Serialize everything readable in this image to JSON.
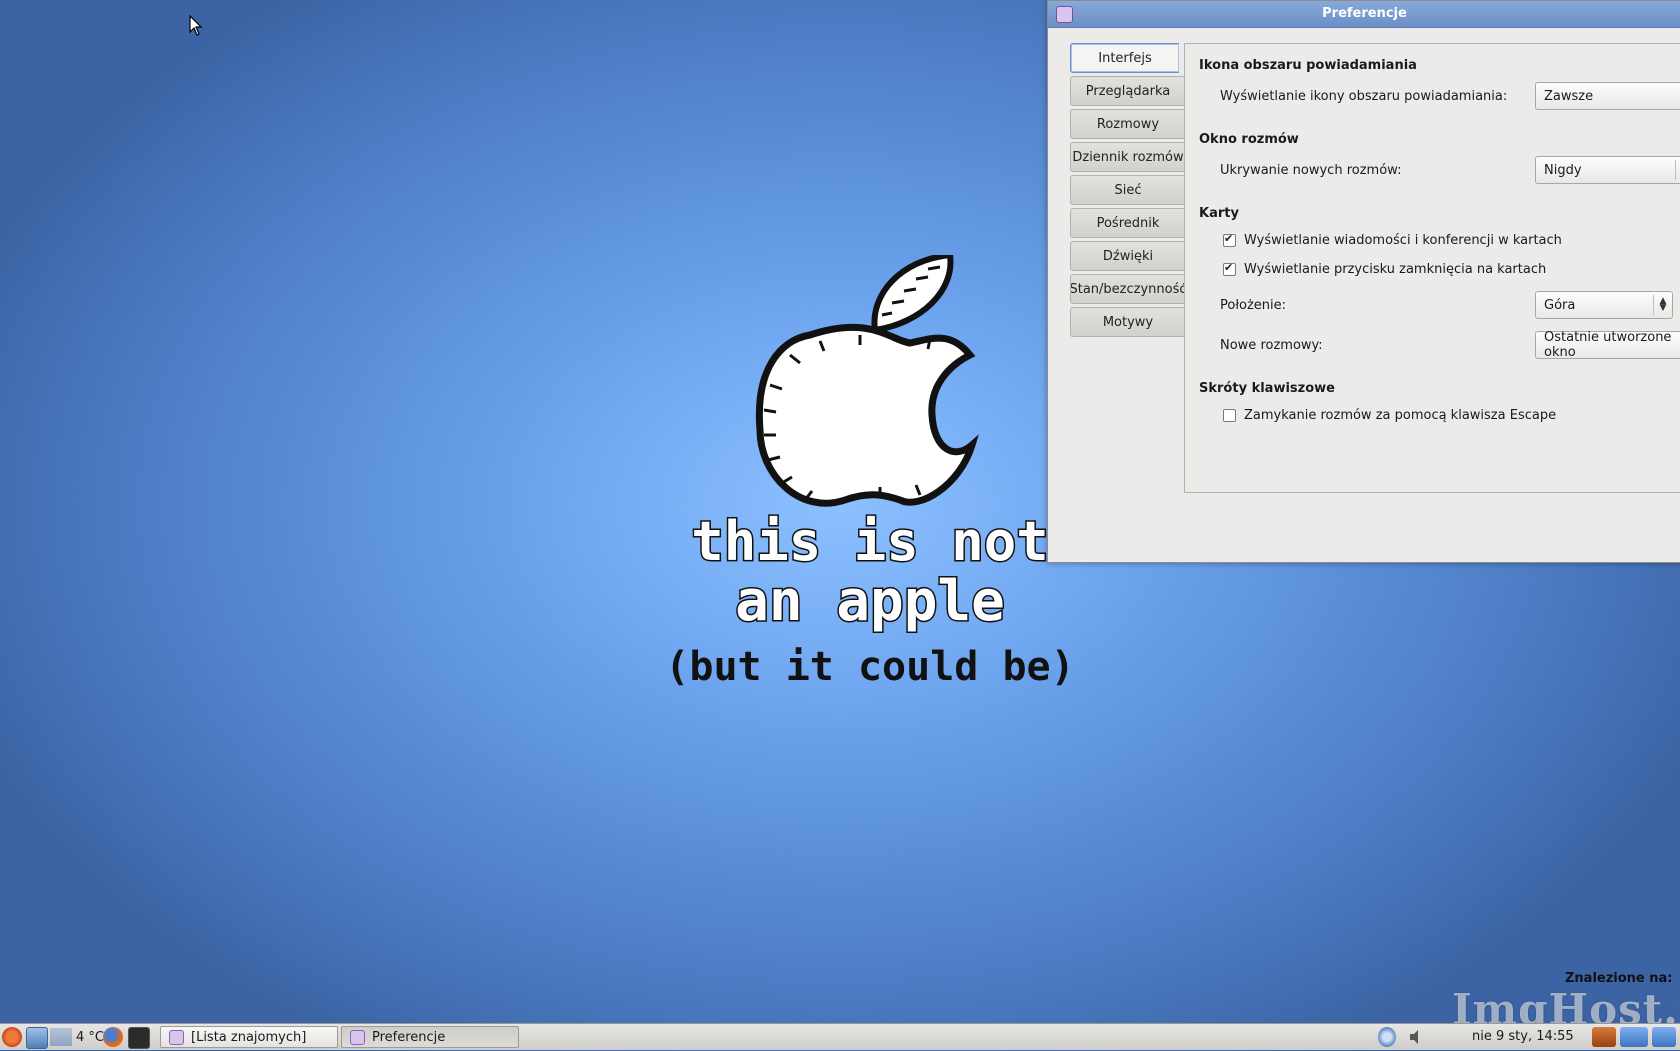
{
  "desktop": {
    "wallpaper": {
      "line1": "this is not",
      "line2": "an apple",
      "line3": "(but it could be)"
    },
    "watermark": {
      "found_on": "Znalezione na:",
      "brand": "ImgHost.pl"
    }
  },
  "dialog": {
    "title": "Preferencje",
    "tabs": [
      {
        "label": "Interfejs",
        "active": true
      },
      {
        "label": "Przeglądarka"
      },
      {
        "label": "Rozmowy"
      },
      {
        "label": "Dziennik rozmów"
      },
      {
        "label": "Sieć"
      },
      {
        "label": "Pośrednik"
      },
      {
        "label": "Dźwięki"
      },
      {
        "label": "Stan/bezczynność"
      },
      {
        "label": "Motywy"
      }
    ],
    "sections": {
      "tray": {
        "heading": "Ikona obszaru powiadamiania",
        "show_icon_label": "Wyświetlanie ikony obszaru powiadamiania:",
        "show_icon_value": "Zawsze"
      },
      "conv_window": {
        "heading": "Okno rozmów",
        "hide_new_label": "Ukrywanie nowych rozmów:",
        "hide_new_value": "Nigdy"
      },
      "tabs": {
        "heading": "Karty",
        "show_in_tabs": "Wyświetlanie wiadomości i konferencji w kartach",
        "show_close_btn": "Wyświetlanie przycisku zamknięcia na kartach",
        "position_label": "Położenie:",
        "position_value": "Góra",
        "new_conv_label": "Nowe rozmowy:",
        "new_conv_value": "Ostatnie utworzone okno"
      },
      "shortcuts": {
        "heading": "Skróty klawiszowe",
        "escape_close": "Zamykanie rozmów za pomocą klawisza Escape"
      }
    }
  },
  "taskbar": {
    "temperature": "4 °C",
    "buttons": [
      {
        "label": "[Lista znajomych]"
      },
      {
        "label": "Preferencje",
        "active": true
      }
    ],
    "clock": "nie  9 sty, 14:55"
  }
}
